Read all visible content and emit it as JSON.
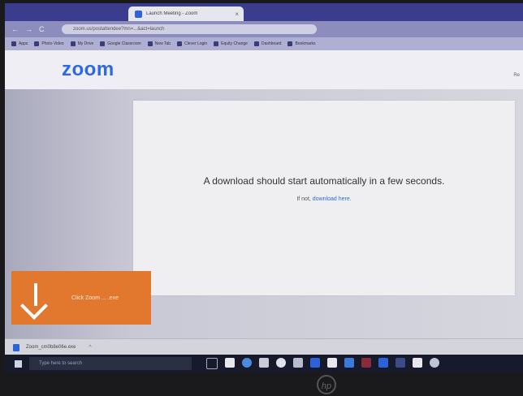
{
  "browser": {
    "tab_title": "Launch Meeting - Zoom",
    "tab_close": "×",
    "nav": {
      "back": "←",
      "forward": "→",
      "reload": "C"
    },
    "address": "zoom.us/postattendee?mn=...&act=launch",
    "bookmarks": [
      "Apps",
      "Photo Video",
      "My Drive",
      "Google Classroom",
      "New Tab",
      "Clever Login",
      "Equity Change",
      "Dashboard",
      "Bookmarks"
    ]
  },
  "zoom": {
    "logo": "zoom",
    "message": "A download should start automatically in a few seconds.",
    "sub_prefix": "If not, ",
    "sub_link": "download here."
  },
  "callout": {
    "text": "Click Zoom ... .exe",
    "color": "#e2782e"
  },
  "download_shelf": {
    "filename": "Zoom_cm0b8e06e.exe",
    "chevron": "^"
  },
  "taskbar": {
    "search_placeholder": "Type here to search",
    "icons": [
      "task-view-icon",
      "file-icon",
      "chrome-icon",
      "mail-icon",
      "app-icon",
      "app-icon",
      "store-icon",
      "app-icon",
      "app-icon",
      "app-icon",
      "app-icon",
      "app-icon",
      "camera-icon",
      "app-icon"
    ]
  }
}
